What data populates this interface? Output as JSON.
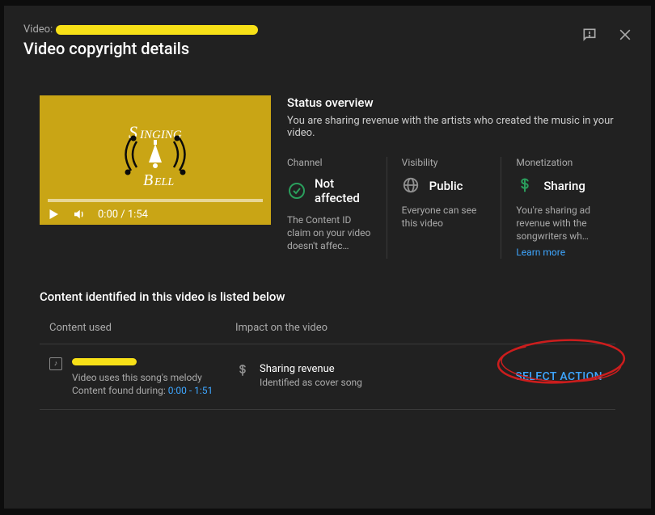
{
  "header": {
    "video_label": "Video:",
    "title": "Video copyright details"
  },
  "status": {
    "heading": "Status overview",
    "summary": "You are sharing revenue with the artists who created the music in your video.",
    "channel": {
      "label": "Channel",
      "value": "Not affected",
      "desc": "The Content ID claim on your video doesn't affec…"
    },
    "visibility": {
      "label": "Visibility",
      "value": "Public",
      "desc": "Everyone can see this video"
    },
    "monetization": {
      "label": "Monetization",
      "value": "Sharing",
      "desc": "You're sharing ad revenue with the songwriters wh…",
      "learn_more": "Learn more"
    }
  },
  "player": {
    "time": "0:00 / 1:54"
  },
  "content_section": {
    "heading": "Content identified in this video is listed below",
    "th_used": "Content used",
    "th_impact": "Impact on the video"
  },
  "row": {
    "melody_text": "Video uses this song's melody",
    "found_label": "Content found during:",
    "found_range": "0:00 - 1:51",
    "impact_title": "Sharing revenue",
    "impact_sub": "Identified as cover song",
    "action": "SELECT ACTION"
  }
}
